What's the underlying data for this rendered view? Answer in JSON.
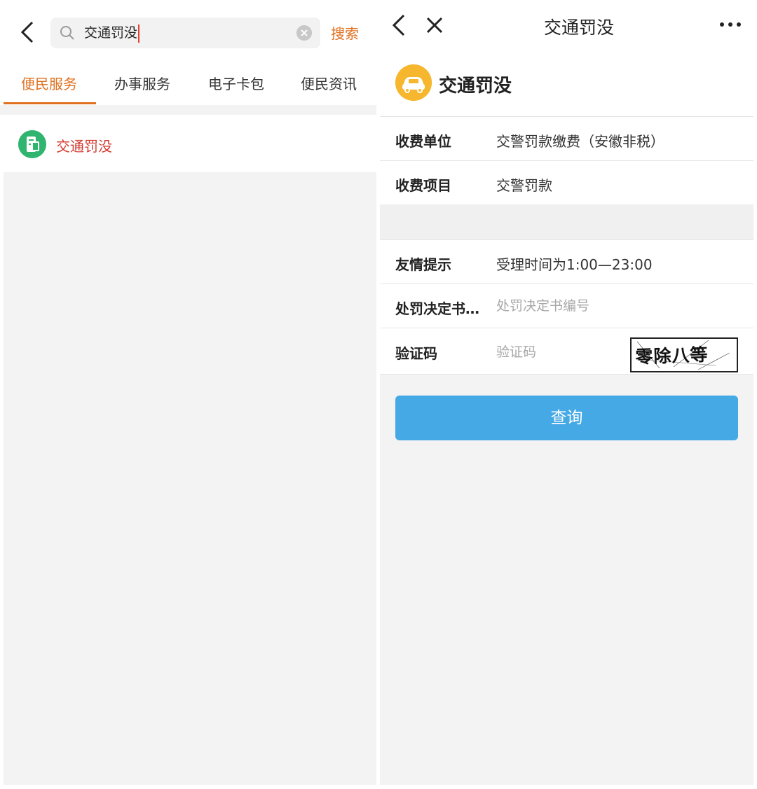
{
  "left": {
    "search": {
      "value": "交通罚没",
      "action_label": "搜索"
    },
    "tabs": [
      {
        "label": "便民服务",
        "active": true
      },
      {
        "label": "办事服务",
        "active": false
      },
      {
        "label": "电子卡包",
        "active": false
      },
      {
        "label": "便民资讯",
        "active": false
      }
    ],
    "results": [
      {
        "label": "交通罚没",
        "icon": "green-app-icon"
      }
    ]
  },
  "right": {
    "header": {
      "title": "交通罚没"
    },
    "service": {
      "name": "交通罚没",
      "icon": "car-icon"
    },
    "rows": [
      {
        "label": "收费单位",
        "value": "交警罚款缴费（安徽非税）"
      },
      {
        "label": "收费项目",
        "value": "交警罚款"
      }
    ],
    "tip": {
      "label": "友情提示",
      "value": "受理时间为1:00—23:00"
    },
    "decision": {
      "label": "处罚决定书…",
      "placeholder": "处罚决定书编号"
    },
    "captcha": {
      "label": "验证码",
      "placeholder": "验证码",
      "image_text": "零除八等于?"
    },
    "query_label": "查询"
  },
  "colors": {
    "accent_orange": "#e0701f",
    "result_red": "#d33a2f",
    "button_blue": "#45a9e5",
    "logo_yellow": "#f6b62d",
    "app_green": "#2fb56f"
  }
}
